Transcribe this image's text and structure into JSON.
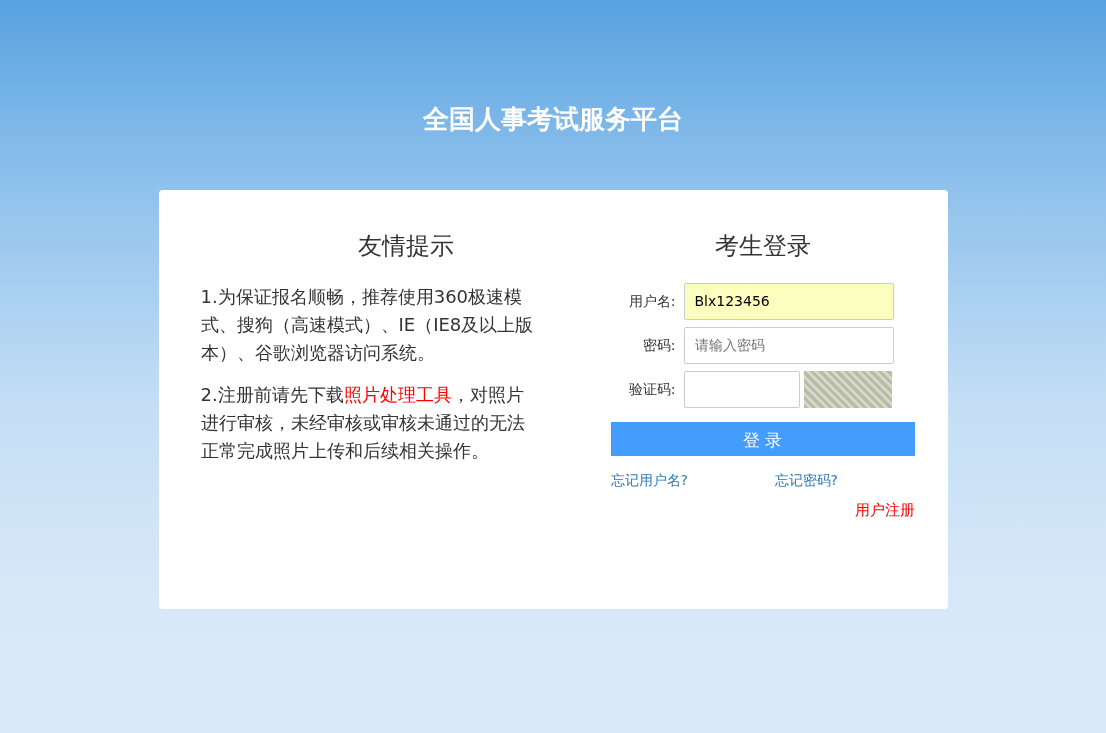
{
  "site_title": "全国人事考试服务平台",
  "tips": {
    "heading": "友情提示",
    "items": [
      {
        "text": "1.为保证报名顺畅，推荐使用360极速模式、搜狗（高速模式）、IE（IE8及以上版本）、谷歌浏览器访问系统。"
      },
      {
        "text": "2.注册前请先下载",
        "link": "照片处理工具",
        "after": "，对照片进行审核，未经审核或审核未通过的无法正常完成照片上传和后续相关操作。"
      }
    ]
  },
  "login": {
    "heading": "考生登录",
    "fields": [
      {
        "kind": "text",
        "label": "用户名:",
        "value": "Blx123456",
        "autofilled": true
      },
      {
        "kind": "password",
        "label": "密码:",
        "placeholder": "请输入密码",
        "autofilled": false
      },
      {
        "kind": "captcha",
        "label": "验证码:",
        "autofilled": false
      }
    ],
    "button": "登 录",
    "forgot_username": "忘记用户名?",
    "forgot_password": "忘记密码?",
    "register": "用户注册"
  }
}
